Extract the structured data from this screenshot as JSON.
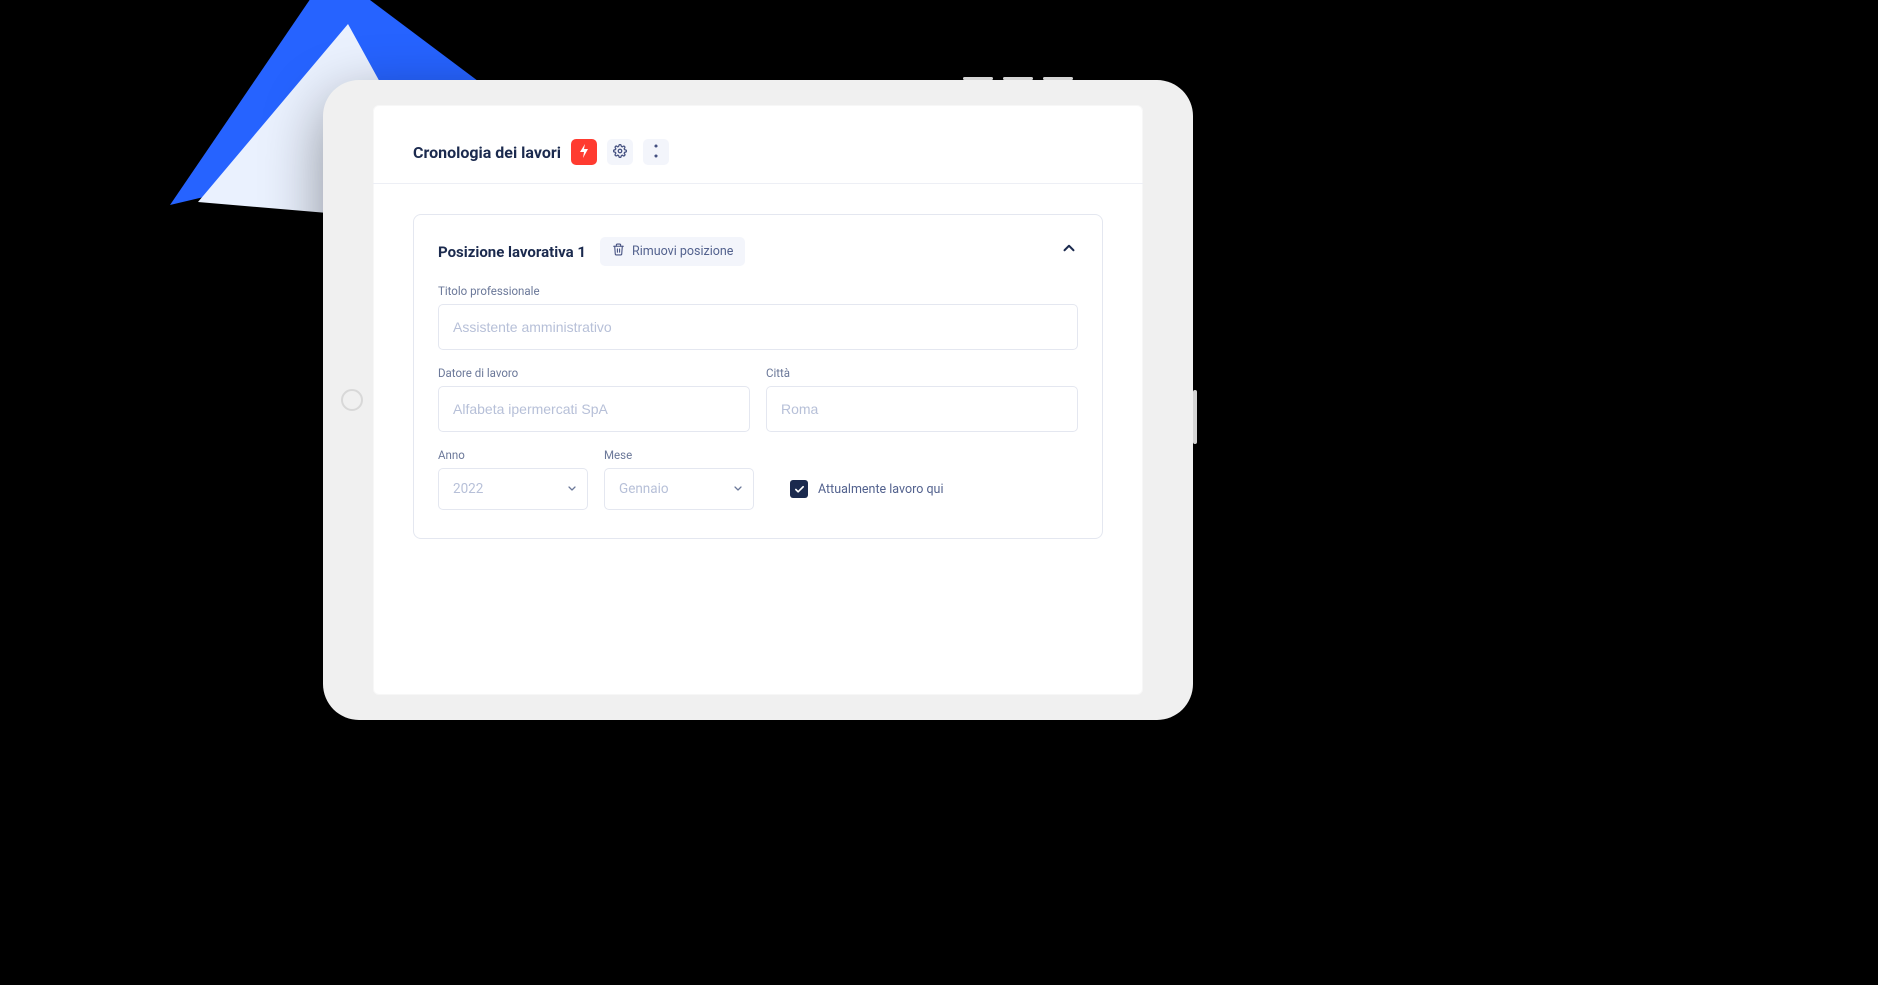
{
  "section": {
    "title": "Cronologia dei lavori"
  },
  "card": {
    "title": "Posizione lavorativa 1",
    "remove_label": "Rimuovi posizione",
    "fields": {
      "job_title_label": "Titolo professionale",
      "job_title_placeholder": "Assistente amministrativo",
      "employer_label": "Datore di lavoro",
      "employer_placeholder": "Alfabeta ipermercati SpA",
      "city_label": "Città",
      "city_placeholder": "Roma",
      "year_label": "Anno",
      "year_value": "2022",
      "month_label": "Mese",
      "month_value": "Gennaio",
      "current_label": "Attualmente lavoro qui",
      "current_checked": true
    }
  }
}
